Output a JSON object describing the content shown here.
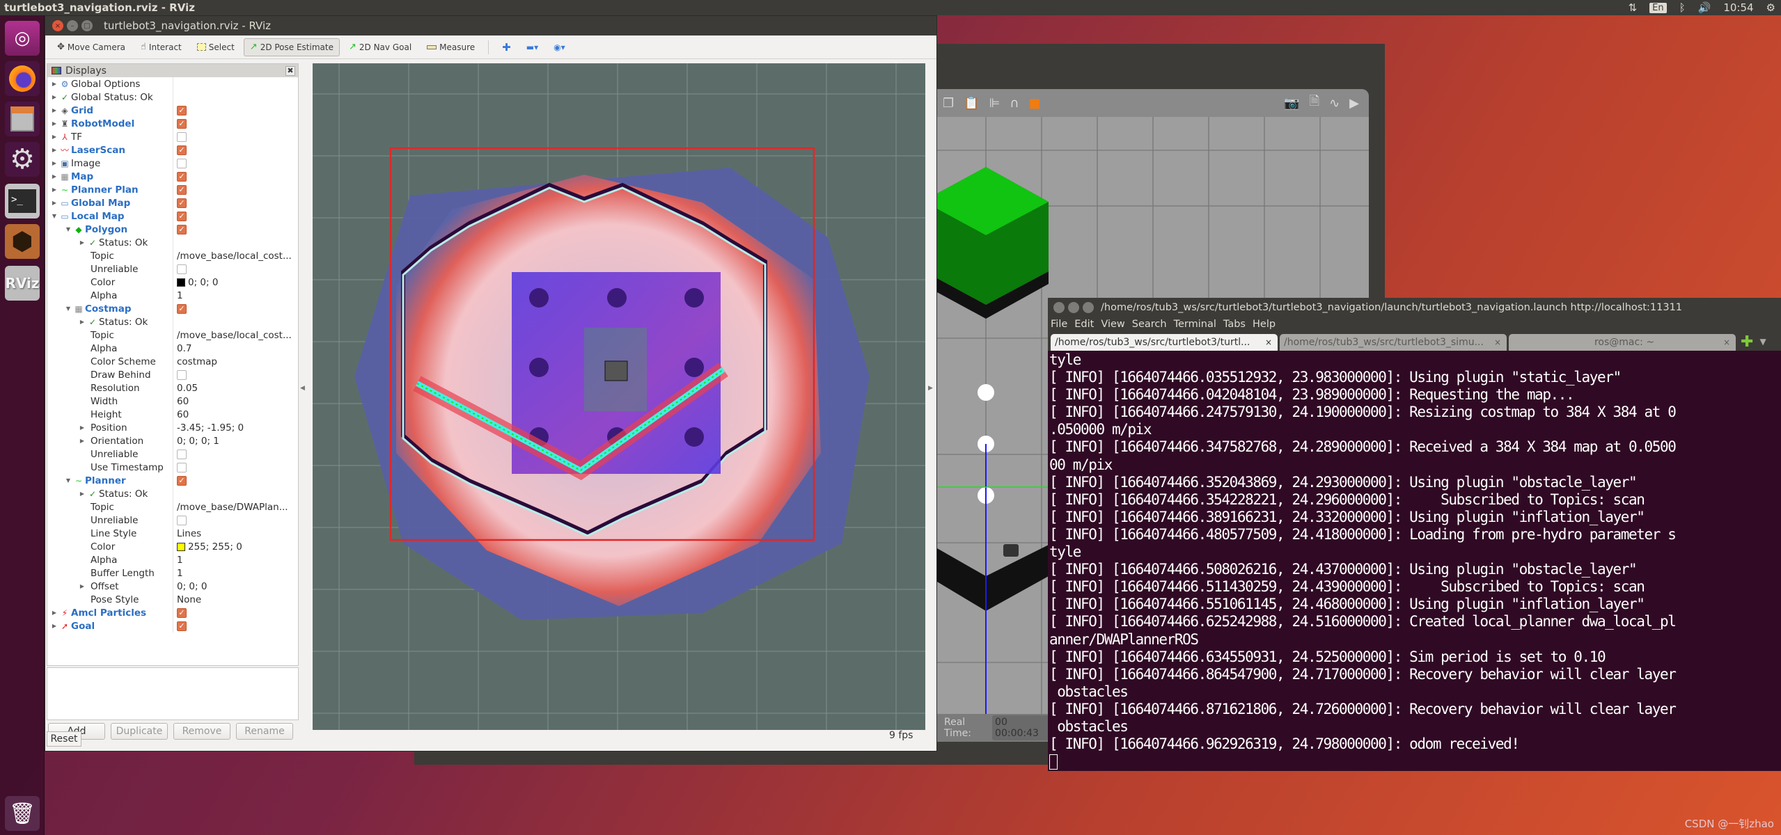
{
  "top_panel": {
    "app_title": "turtlebot3_navigation.rviz - RViz",
    "lang": "En",
    "clock": "10:54",
    "icons": [
      "network-icon",
      "keyboard-lang-icon",
      "bluetooth-icon",
      "volume-icon",
      "power-gear-icon"
    ]
  },
  "launcher": {
    "items": [
      {
        "name": "ubuntu-dash",
        "glyph": "◎"
      },
      {
        "name": "firefox",
        "glyph": "🦊"
      },
      {
        "name": "files",
        "glyph": "🗄"
      },
      {
        "name": "system-settings",
        "glyph": "⚙"
      },
      {
        "name": "terminal",
        "glyph": ">_"
      },
      {
        "name": "gazebo",
        "glyph": "⬢"
      },
      {
        "name": "rviz",
        "glyph": "RViz"
      },
      {
        "name": "trash",
        "glyph": "🗑"
      }
    ]
  },
  "rviz": {
    "window_title": "turtlebot3_navigation.rviz - RViz",
    "toolbar": [
      {
        "label": "Move Camera",
        "icon": "✥",
        "active": false
      },
      {
        "label": "Interact",
        "icon": "☝",
        "active": false
      },
      {
        "label": "Select",
        "icon": "⬚",
        "active": false
      },
      {
        "label": "2D Pose Estimate",
        "icon": "↗",
        "active": true
      },
      {
        "label": "2D Nav Goal",
        "icon": "↗",
        "active": false
      },
      {
        "label": "Measure",
        "icon": "▭",
        "active": false
      }
    ],
    "toolbar_extra": {
      "add": "✚",
      "remove": "▬▾",
      "view": "◉▾"
    },
    "displays_title": "Displays",
    "tree": [
      {
        "level": 0,
        "arrow": "▶",
        "icon": "⚙",
        "icon_color": "#4a7fc4",
        "label": "Global Options",
        "blue": false
      },
      {
        "level": 0,
        "arrow": "▶",
        "icon": "✓",
        "icon_color": "#2a8a2a",
        "label": "Global Status: Ok",
        "blue": false
      },
      {
        "level": 0,
        "arrow": "▶",
        "icon": "◈",
        "icon_color": "#555",
        "label": "Grid",
        "blue": true,
        "check": true
      },
      {
        "level": 0,
        "arrow": "▶",
        "icon": "♜",
        "icon_color": "#555",
        "label": "RobotModel",
        "blue": true,
        "check": true
      },
      {
        "level": 0,
        "arrow": "▶",
        "icon": "⅄",
        "icon_color": "#d33",
        "label": "TF",
        "blue": false,
        "check": false
      },
      {
        "level": 0,
        "arrow": "▶",
        "icon": "〰",
        "icon_color": "#e02020",
        "label": "LaserScan",
        "blue": true,
        "check": true
      },
      {
        "level": 0,
        "arrow": "▶",
        "icon": "▣",
        "icon_color": "#4a6fa0",
        "label": "Image",
        "blue": false,
        "check": false
      },
      {
        "level": 0,
        "arrow": "▶",
        "icon": "▦",
        "icon_color": "#888",
        "label": "Map",
        "blue": true,
        "check": true
      },
      {
        "level": 0,
        "arrow": "▶",
        "icon": "∼",
        "icon_color": "#22cc22",
        "label": "Planner Plan",
        "blue": true,
        "check": true
      },
      {
        "level": 0,
        "arrow": "▶",
        "icon": "▭",
        "icon_color": "#5a8ac8",
        "label": "Global Map",
        "blue": true,
        "check": true
      },
      {
        "level": 0,
        "arrow": "▼",
        "icon": "▭",
        "icon_color": "#5a8ac8",
        "label": "Local Map",
        "blue": true,
        "check": true
      },
      {
        "level": 1,
        "arrow": "▼",
        "icon": "◆",
        "icon_color": "#10b010",
        "label": "Polygon",
        "blue": true,
        "check": true
      },
      {
        "level": 2,
        "arrow": "▶",
        "icon": "✓",
        "icon_color": "#2a8a2a",
        "label": "Status: Ok",
        "blue": false
      },
      {
        "level": 2,
        "arrow": "",
        "icon": "",
        "label": "Topic",
        "value": "/move_base/local_cost..."
      },
      {
        "level": 2,
        "arrow": "",
        "icon": "",
        "label": "Unreliable",
        "check": false
      },
      {
        "level": 2,
        "arrow": "",
        "icon": "",
        "label": "Color",
        "swatch": "#000000",
        "value": "0; 0; 0"
      },
      {
        "level": 2,
        "arrow": "",
        "icon": "",
        "label": "Alpha",
        "value": "1"
      },
      {
        "level": 1,
        "arrow": "▼",
        "icon": "▦",
        "icon_color": "#888",
        "label": "Costmap",
        "blue": true,
        "check": true
      },
      {
        "level": 2,
        "arrow": "▶",
        "icon": "✓",
        "icon_color": "#2a8a2a",
        "label": "Status: Ok",
        "blue": false
      },
      {
        "level": 2,
        "arrow": "",
        "icon": "",
        "label": "Topic",
        "value": "/move_base/local_cost..."
      },
      {
        "level": 2,
        "arrow": "",
        "icon": "",
        "label": "Alpha",
        "value": "0.7"
      },
      {
        "level": 2,
        "arrow": "",
        "icon": "",
        "label": "Color Scheme",
        "value": "costmap"
      },
      {
        "level": 2,
        "arrow": "",
        "icon": "",
        "label": "Draw Behind",
        "check": false
      },
      {
        "level": 2,
        "arrow": "",
        "icon": "",
        "label": "Resolution",
        "value": "0.05"
      },
      {
        "level": 2,
        "arrow": "",
        "icon": "",
        "label": "Width",
        "value": "60"
      },
      {
        "level": 2,
        "arrow": "",
        "icon": "",
        "label": "Height",
        "value": "60"
      },
      {
        "level": 2,
        "arrow": "▶",
        "icon": "",
        "label": "Position",
        "value": "-3.45; -1.95; 0"
      },
      {
        "level": 2,
        "arrow": "▶",
        "icon": "",
        "label": "Orientation",
        "value": "0; 0; 0; 1"
      },
      {
        "level": 2,
        "arrow": "",
        "icon": "",
        "label": "Unreliable",
        "check": false
      },
      {
        "level": 2,
        "arrow": "",
        "icon": "",
        "label": "Use Timestamp",
        "check": false
      },
      {
        "level": 1,
        "arrow": "▼",
        "icon": "∼",
        "icon_color": "#22cc22",
        "label": "Planner",
        "blue": true,
        "check": true
      },
      {
        "level": 2,
        "arrow": "▶",
        "icon": "✓",
        "icon_color": "#2a8a2a",
        "label": "Status: Ok",
        "blue": false
      },
      {
        "level": 2,
        "arrow": "",
        "icon": "",
        "label": "Topic",
        "value": "/move_base/DWAPlan..."
      },
      {
        "level": 2,
        "arrow": "",
        "icon": "",
        "label": "Unreliable",
        "check": false
      },
      {
        "level": 2,
        "arrow": "",
        "icon": "",
        "label": "Line Style",
        "value": "Lines"
      },
      {
        "level": 2,
        "arrow": "",
        "icon": "",
        "label": "Color",
        "swatch": "#ffff00",
        "value": "255; 255; 0"
      },
      {
        "level": 2,
        "arrow": "",
        "icon": "",
        "label": "Alpha",
        "value": "1"
      },
      {
        "level": 2,
        "arrow": "",
        "icon": "",
        "label": "Buffer Length",
        "value": "1"
      },
      {
        "level": 2,
        "arrow": "▶",
        "icon": "",
        "label": "Offset",
        "value": "0; 0; 0"
      },
      {
        "level": 2,
        "arrow": "",
        "icon": "",
        "label": "Pose Style",
        "value": "None"
      },
      {
        "level": 0,
        "arrow": "▶",
        "icon": "⚡",
        "icon_color": "#e02020",
        "label": "Amcl Particles",
        "blue": true,
        "check": true
      },
      {
        "level": 0,
        "arrow": "▶",
        "icon": "➚",
        "icon_color": "#e02020",
        "label": "Goal",
        "blue": true,
        "check": true
      }
    ],
    "buttons": {
      "add": "Add",
      "duplicate": "Duplicate",
      "remove": "Remove",
      "rename": "Rename"
    },
    "reset_label": "Reset",
    "fps": "9 fps",
    "colors": {
      "grid_bg": "#5c6d69",
      "footprint": "#e02828",
      "laser": "#22dd22"
    }
  },
  "gazebo": {
    "real_time_label": "Real Time:",
    "real_time_value": "00 00:00:43"
  },
  "terminal": {
    "title": "/home/ros/tub3_ws/src/turtlebot3/turtlebot3_navigation/launch/turtlebot3_navigation.launch http://localhost:11311",
    "menu": [
      "File",
      "Edit",
      "View",
      "Search",
      "Terminal",
      "Tabs",
      "Help"
    ],
    "tabs": [
      {
        "label": "/home/ros/tub3_ws/src/turtlebot3/turtl...",
        "active": true
      },
      {
        "label": "/home/ros/tub3_ws/src/turtlebot3_simu...",
        "active": false
      },
      {
        "label": "ros@mac: ~",
        "active": false
      }
    ],
    "lines": [
      "tyle",
      "[ INFO] [1664074466.035512932, 23.983000000]: Using plugin \"static_layer\"",
      "[ INFO] [1664074466.042048104, 23.989000000]: Requesting the map...",
      "[ INFO] [1664074466.247579130, 24.190000000]: Resizing costmap to 384 X 384 at 0",
      ".050000 m/pix",
      "[ INFO] [1664074466.347582768, 24.289000000]: Received a 384 X 384 map at 0.0500",
      "00 m/pix",
      "[ INFO] [1664074466.352043869, 24.293000000]: Using plugin \"obstacle_layer\"",
      "[ INFO] [1664074466.354228221, 24.296000000]:     Subscribed to Topics: scan",
      "[ INFO] [1664074466.389166231, 24.332000000]: Using plugin \"inflation_layer\"",
      "[ INFO] [1664074466.480577509, 24.418000000]: Loading from pre-hydro parameter s",
      "tyle",
      "[ INFO] [1664074466.508026216, 24.437000000]: Using plugin \"obstacle_layer\"",
      "[ INFO] [1664074466.511430259, 24.439000000]:     Subscribed to Topics: scan",
      "[ INFO] [1664074466.551061145, 24.468000000]: Using plugin \"inflation_layer\"",
      "[ INFO] [1664074466.625242988, 24.516000000]: Created local_planner dwa_local_pl",
      "anner/DWAPlannerROS",
      "[ INFO] [1664074466.634550931, 24.525000000]: Sim period is set to 0.10",
      "[ INFO] [1664074466.864547900, 24.717000000]: Recovery behavior will clear layer",
      " obstacles",
      "[ INFO] [1664074466.871621806, 24.726000000]: Recovery behavior will clear layer",
      " obstacles",
      "[ INFO] [1664074466.962926319, 24.798000000]: odom received!"
    ]
  },
  "watermark": "CSDN @一钊zhao"
}
